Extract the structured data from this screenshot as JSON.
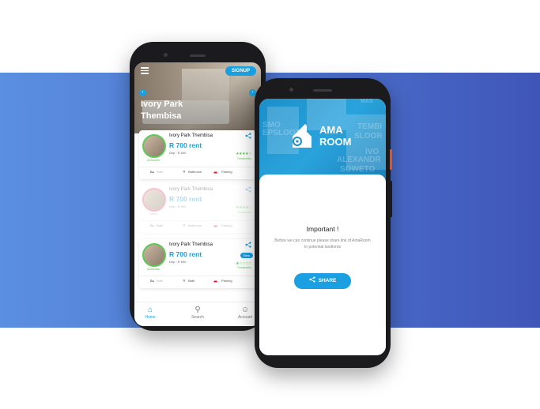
{
  "phone_home": {
    "signup_label": "SIGNUP",
    "hero_title": "Ivory Park Thembisa",
    "listings": [
      {
        "name": "Ivory Park Thembisa",
        "rent": "R 700 rent",
        "deposit": "Dep : R 600",
        "status": "Available",
        "rating_label": "Trustworthy",
        "amenities": [
          "Bath",
          "Bathroom",
          "Parking"
        ],
        "badge": ""
      },
      {
        "name": "Ivory Park Thembisa",
        "rent": "R 700 rent",
        "deposit": "Dep : R 600",
        "status": "Taken",
        "rating_label": "Trustworthy",
        "amenities": [
          "Bath",
          "Bathroom",
          "Parking"
        ],
        "badge": ""
      },
      {
        "name": "Ivory Park Thembisa",
        "rent": "R 700 rent",
        "deposit": "Dep : R 600",
        "status": "Available",
        "rating_label": "Trustworthy",
        "amenities": [
          "Bath",
          "Bath",
          "Parking"
        ],
        "badge": "New"
      }
    ],
    "tabs": [
      {
        "label": "Home",
        "icon": "home-icon"
      },
      {
        "label": "Search",
        "icon": "search-icon"
      },
      {
        "label": "Account",
        "icon": "account-icon"
      }
    ]
  },
  "phone_share": {
    "logo_text": "AMA ROOM",
    "title": "Important !",
    "message": "Before we can continue please share link of  AmaRoom to potential landlords",
    "share_label": "SHARE",
    "bg_words": [
      "SMO",
      "EPSLOOT",
      "TEMBI",
      "SLOOR",
      "IVO",
      "ALEXANDR",
      "SOWETO",
      "MAS"
    ]
  },
  "colors": {
    "accent": "#1aa0e0",
    "green": "#5dcc55",
    "band_start": "#5b8fe0",
    "band_end": "#3f56b8"
  }
}
